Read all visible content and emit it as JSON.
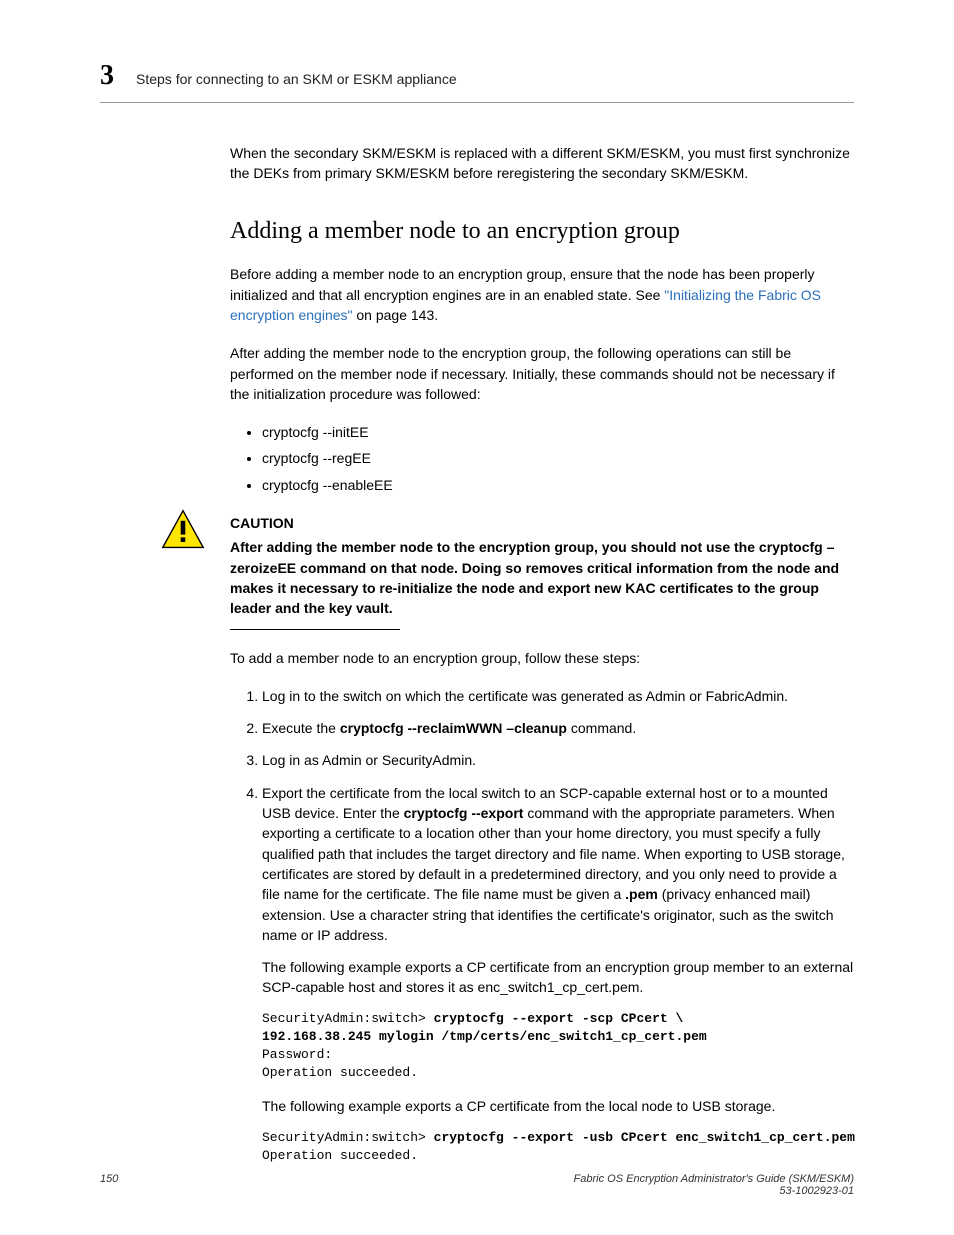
{
  "header": {
    "chapter": "3",
    "title": "Steps for connecting to an SKM or ESKM appliance"
  },
  "intro": "When the secondary SKM/ESKM is replaced with a different SKM/ESKM, you must first synchronize the DEKs from primary SKM/ESKM before reregistering the secondary SKM/ESKM.",
  "section_heading": "Adding a member node to an encryption group",
  "p1a": "Before adding a member node to an encryption group, ensure that the node has been properly initialized and that all encryption engines are in an enabled state. See ",
  "link": "\"Initializing the Fabric OS encryption engines\"",
  "p1b": " on page 143.",
  "p2": "After adding the member node to the encryption group, the following operations can still be performed on the member node if necessary. Initially, these commands should not be necessary if the initialization procedure was followed:",
  "bullets": [
    "cryptocfg --initEE",
    "cryptocfg --regEE",
    "cryptocfg --enableEE"
  ],
  "caution": {
    "label": "CAUTION",
    "body": "After adding the member node to the encryption group, you should not use the cryptocfg –zeroizeEE command on that node. Doing so removes critical information from the node and makes it necessary to re-initialize the node and export new KAC certificates to the group leader and the key vault."
  },
  "p3": "To add a member node to an encryption group, follow these steps:",
  "steps": {
    "s1": "Log in to the switch on which the certificate was generated as Admin or FabricAdmin.",
    "s2_a": "Execute the ",
    "s2_b": "cryptocfg  --reclaimWWN  –cleanup",
    "s2_c": " command.",
    "s3": "Log in as Admin or SecurityAdmin.",
    "s4_a": "Export the certificate from the local switch to an SCP-capable external host or to a mounted USB device. Enter the ",
    "s4_b": "cryptocfg  --export",
    "s4_c": " command with the appropriate parameters. When exporting a certificate to a location other than your home directory, you must specify a fully qualified path that includes the target directory and file name. When exporting to USB storage, certificates are stored by default in a predetermined directory, and you only need to provide a file name for the certificate. The file name must be given a ",
    "s4_d": ".pem",
    "s4_e": " (privacy enhanced mail) extension. Use a character string that identifies the certificate's originator, such as the switch name or IP address.",
    "s4_para2": "The following example exports a CP certificate from an encryption group member to an external SCP-capable host and stores it as enc_switch1_cp_cert.pem.",
    "code1_prompt": "SecurityAdmin:switch> ",
    "code1_cmd": "cryptocfg --export -scp CPcert \\\n192.168.38.245 mylogin /tmp/certs/enc_switch1_cp_cert.pem",
    "code1_out": "Password:\nOperation succeeded.",
    "s4_para3": "The following example exports a CP certificate from the local node to USB storage.",
    "code2_prompt": "SecurityAdmin:switch> ",
    "code2_cmd": "cryptocfg --export -usb CPcert enc_switch1_cp_cert.pem",
    "code2_out": "Operation succeeded."
  },
  "footer": {
    "page": "150",
    "title": "Fabric OS Encryption Administrator's Guide (SKM/ESKM)",
    "docnum": "53-1002923-01"
  }
}
